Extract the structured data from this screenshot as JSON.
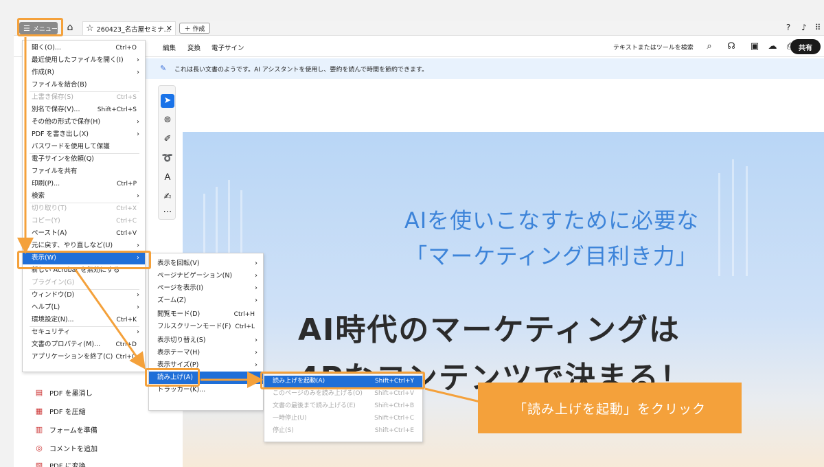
{
  "tabbar": {
    "menu_label": "メニュー",
    "tab_title": "260423_名古屋セミナ...",
    "new_label": "作成"
  },
  "toolbar": {
    "tabs": [
      "編集",
      "変換",
      "電子サイン"
    ],
    "search_text": "テキストまたはツールを検索",
    "share_label": "共有"
  },
  "banner": {
    "text": "これは長い文書のようです。AI アシスタントを使用し、要約を読んで時間を節約できます。"
  },
  "document": {
    "subtitle_line1": "AIを使いこなすために必要な",
    "subtitle_line2": "「マーケティング目利き力」",
    "title_line1": "AI時代のマーケティングは",
    "title_line2": "4Pなコンテンツで決まる！"
  },
  "main_menu": [
    {
      "label": "開く(O)...",
      "shortcut": "Ctrl+O",
      "arrow": false,
      "disabled": false
    },
    {
      "label": "最近使用したファイルを開く(I)",
      "shortcut": "",
      "arrow": true,
      "disabled": false
    },
    {
      "label": "作成(R)",
      "shortcut": "",
      "arrow": true,
      "disabled": false
    },
    {
      "label": "ファイルを結合(B)",
      "shortcut": "",
      "arrow": false,
      "disabled": false
    },
    {
      "label": "上書き保存(S)",
      "shortcut": "Ctrl+S",
      "arrow": false,
      "disabled": true
    },
    {
      "label": "別名で保存(V)...",
      "shortcut": "Shift+Ctrl+S",
      "arrow": false,
      "disabled": false
    },
    {
      "label": "その他の形式で保存(H)",
      "shortcut": "",
      "arrow": true,
      "disabled": false
    },
    {
      "label": "PDF を書き出し(X)",
      "shortcut": "",
      "arrow": true,
      "disabled": false
    },
    {
      "label": "パスワードを使用して保護",
      "shortcut": "",
      "arrow": false,
      "disabled": false
    },
    {
      "label": "電子サインを依頼(Q)",
      "shortcut": "",
      "arrow": false,
      "disabled": false
    },
    {
      "label": "ファイルを共有",
      "shortcut": "",
      "arrow": false,
      "disabled": false
    },
    {
      "label": "印刷(P)...",
      "shortcut": "Ctrl+P",
      "arrow": false,
      "disabled": false
    },
    {
      "label": "検索",
      "shortcut": "",
      "arrow": true,
      "disabled": false
    },
    {
      "label": "切り取り(T)",
      "shortcut": "Ctrl+X",
      "arrow": false,
      "disabled": true
    },
    {
      "label": "コピー(Y)",
      "shortcut": "Ctrl+C",
      "arrow": false,
      "disabled": true
    },
    {
      "label": "ペースト(A)",
      "shortcut": "Ctrl+V",
      "arrow": false,
      "disabled": false
    },
    {
      "label": "元に戻す、やり直しなど(U)",
      "shortcut": "",
      "arrow": true,
      "disabled": false
    },
    {
      "label": "表示(W)",
      "shortcut": "",
      "arrow": true,
      "disabled": false
    },
    {
      "label": "新しい Acrobat を無効にする",
      "shortcut": "",
      "arrow": false,
      "disabled": false
    },
    {
      "label": "プラグイン(G)",
      "shortcut": "",
      "arrow": false,
      "disabled": true
    },
    {
      "label": "ウィンドウ(D)",
      "shortcut": "",
      "arrow": true,
      "disabled": false
    },
    {
      "label": "ヘルプ(L)",
      "shortcut": "",
      "arrow": true,
      "disabled": false
    },
    {
      "label": "環境設定(N)...",
      "shortcut": "Ctrl+K",
      "arrow": false,
      "disabled": false
    },
    {
      "label": "セキュリティ",
      "shortcut": "",
      "arrow": true,
      "disabled": false
    },
    {
      "label": "文書のプロパティ(M)...",
      "shortcut": "Ctrl+D",
      "arrow": false,
      "disabled": false
    },
    {
      "label": "アプリケーションを終了(C)",
      "shortcut": "Ctrl+Q",
      "arrow": false,
      "disabled": false
    }
  ],
  "view_submenu": [
    {
      "label": "表示を回転(V)",
      "shortcut": "",
      "arrow": true
    },
    {
      "label": "ページナビゲーション(N)",
      "shortcut": "",
      "arrow": true
    },
    {
      "label": "ページを表示(I)",
      "shortcut": "",
      "arrow": true
    },
    {
      "label": "ズーム(Z)",
      "shortcut": "",
      "arrow": true
    },
    {
      "label": "閲覧モード(D)",
      "shortcut": "Ctrl+H",
      "arrow": false
    },
    {
      "label": "フルスクリーンモード(F)",
      "shortcut": "Ctrl+L",
      "arrow": false
    },
    {
      "label": "表示切り替え(S)",
      "shortcut": "",
      "arrow": true
    },
    {
      "label": "表示テーマ(H)",
      "shortcut": "",
      "arrow": true
    },
    {
      "label": "表示サイズ(P)",
      "shortcut": "",
      "arrow": true
    },
    {
      "label": "読み上げ(A)",
      "shortcut": "",
      "arrow": true
    },
    {
      "label": "トラッカー(K)...",
      "shortcut": "",
      "arrow": false
    }
  ],
  "read_submenu": [
    {
      "label": "読み上げを起動(A)",
      "shortcut": "Shift+Ctrl+Y",
      "disabled": false
    },
    {
      "label": "このページのみを読み上げる(O)",
      "shortcut": "Shift+Ctrl+V",
      "disabled": true
    },
    {
      "label": "文書の最後まで読み上げる(E)",
      "shortcut": "Shift+Ctrl+B",
      "disabled": true
    },
    {
      "label": "一時停止(U)",
      "shortcut": "Shift+Ctrl+C",
      "disabled": true
    },
    {
      "label": "停止(S)",
      "shortcut": "Shift+Ctrl+E",
      "disabled": true
    }
  ],
  "side_tools": [
    "PDF を墨消し",
    "PDF を圧縮",
    "フォームを準備",
    "コメントを追加",
    "PDF に変換"
  ],
  "callout": "「読み上げを起動」をクリック",
  "colors": {
    "highlight": "#f4a13b",
    "selection": "#1f6fd8"
  }
}
